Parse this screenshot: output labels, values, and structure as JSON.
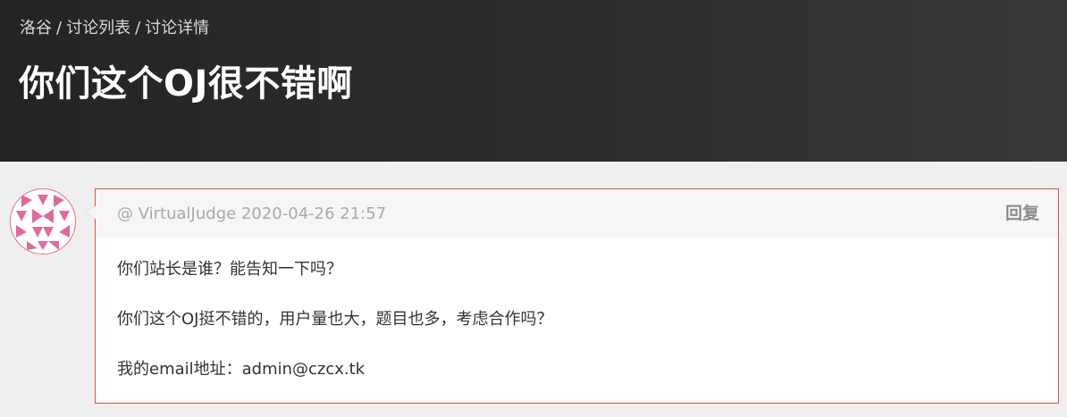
{
  "breadcrumb": {
    "items": [
      "洛谷",
      "讨论列表",
      "讨论详情"
    ],
    "separator": "/"
  },
  "page": {
    "title": "你们这个OJ很不错啊"
  },
  "post": {
    "author_prefix": "@",
    "author": "VirtualJudge",
    "timestamp": "2020-04-26 21:57",
    "reply_label": "回复",
    "paragraphs": [
      "你们站长是谁？能告知一下吗？",
      "你们这个OJ挺不错的，用户量也大，题目也多，考虑合作吗？",
      "我的email地址：admin@czcx.tk"
    ]
  },
  "colors": {
    "header_bg": "#2a2b2d",
    "page_bg": "#efefef",
    "card_border": "#d9534f",
    "avatar_accent": "#e2699e"
  },
  "icons": {
    "avatar": "identicon-avatar"
  }
}
